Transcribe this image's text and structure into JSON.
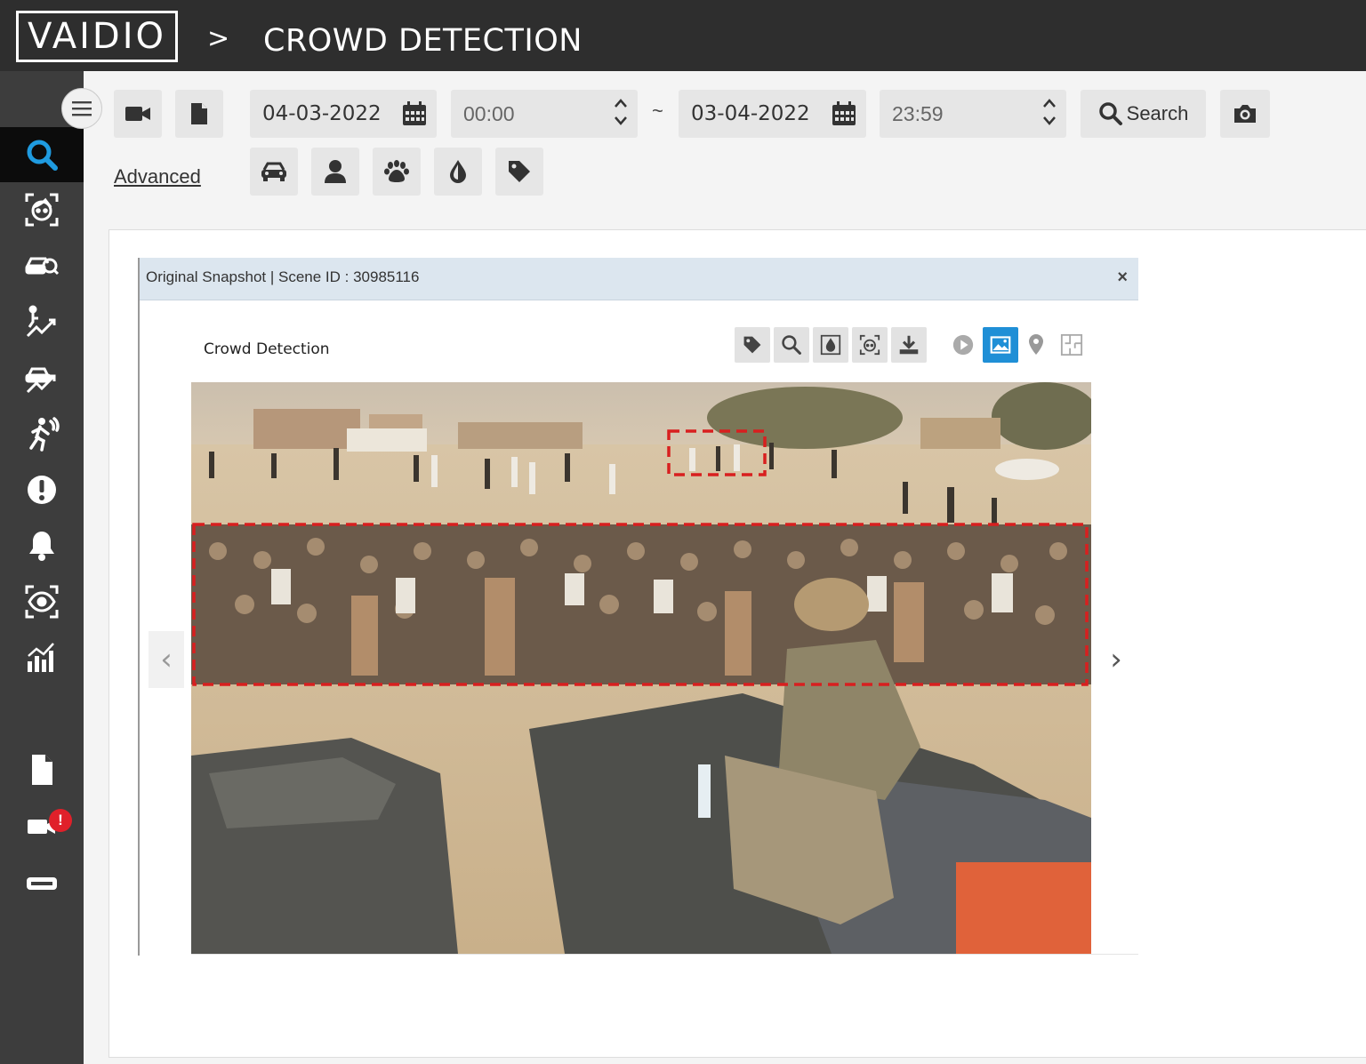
{
  "header": {
    "logo_text": "VAIDIO",
    "breadcrumb_separator": ">",
    "page_title": "CROWD DETECTION"
  },
  "sidebar": {
    "items": [
      {
        "icon": "search-icon",
        "active": true
      },
      {
        "icon": "face-scan-icon"
      },
      {
        "icon": "vehicle-scan-icon"
      },
      {
        "icon": "person-trend-icon"
      },
      {
        "icon": "vehicle-trend-icon"
      },
      {
        "icon": "running-person-icon"
      },
      {
        "icon": "alert-icon"
      },
      {
        "icon": "bell-icon"
      },
      {
        "icon": "eye-scan-icon"
      },
      {
        "icon": "analytics-chart-icon"
      },
      {
        "icon": "document-icon"
      },
      {
        "icon": "camera-alert-icon",
        "badge": "!"
      },
      {
        "icon": "card-icon"
      }
    ]
  },
  "toolbar": {
    "start_date": "04-03-2022",
    "start_time": "00:00",
    "range_separator": "~",
    "end_date": "03-04-2022",
    "end_time": "23:59",
    "search_label": "Search",
    "advanced_label": "Advanced"
  },
  "dialog": {
    "title": "Original Snapshot | Scene ID : 30985116",
    "close_symbol": "×",
    "panel_label": "Crowd Detection",
    "prev_symbol": "‹",
    "next_symbol": "›"
  },
  "colors": {
    "topbar": "#2e2e2e",
    "sidebar": "#3d3d3d",
    "active_tool": "#1f8fd6",
    "detection_box": "#d81f1f",
    "dialog_header": "#dce6ef",
    "badge": "#e0202a"
  }
}
